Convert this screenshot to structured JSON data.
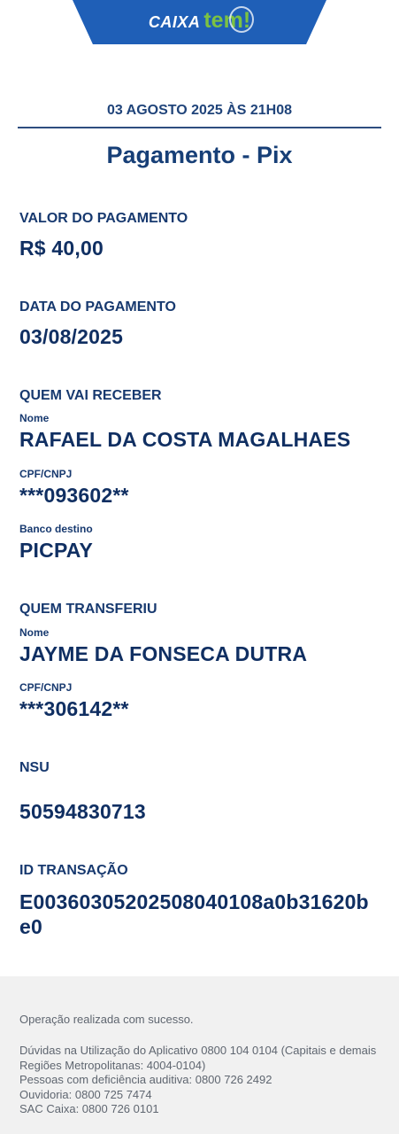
{
  "header": {
    "brand_caixa": "CAIXA",
    "brand_tem": "tem!"
  },
  "receipt": {
    "datetime": "03 AGOSTO 2025 ÀS 21H08",
    "title": "Pagamento - Pix",
    "payment_amount_label": "VALOR DO PAGAMENTO",
    "payment_amount": "R$ 40,00",
    "payment_date_label": "DATA DO PAGAMENTO",
    "payment_date": "03/08/2025",
    "receiver_section": "QUEM VAI RECEBER",
    "receiver_name_label": "Nome",
    "receiver_name": "RAFAEL DA COSTA MAGALHAES",
    "receiver_doc_label": "CPF/CNPJ",
    "receiver_doc": "***093602**",
    "receiver_bank_label": "Banco destino",
    "receiver_bank": "PICPAY",
    "sender_section": "QUEM TRANSFERIU",
    "sender_name_label": "Nome",
    "sender_name": "JAYME DA FONSECA DUTRA",
    "sender_doc_label": "CPF/CNPJ",
    "sender_doc": "***306142**",
    "nsu_label": "NSU",
    "nsu": "50594830713",
    "transaction_id_label": "ID TRANSAÇÃO",
    "transaction_id": "E00360305202508040108a0b31620be0"
  },
  "footer": {
    "status": "Operação realizada com sucesso.",
    "lines": [
      "Dúvidas na Utilização do Aplicativo 0800 104 0104 (Capitais e demais Regiões Metropolitanas: 4004-0104)",
      "Pessoas com deficiência auditiva: 0800 726 2492",
      "Ouvidoria: 0800 725 7474",
      "SAC Caixa: 0800 726 0101"
    ]
  }
}
